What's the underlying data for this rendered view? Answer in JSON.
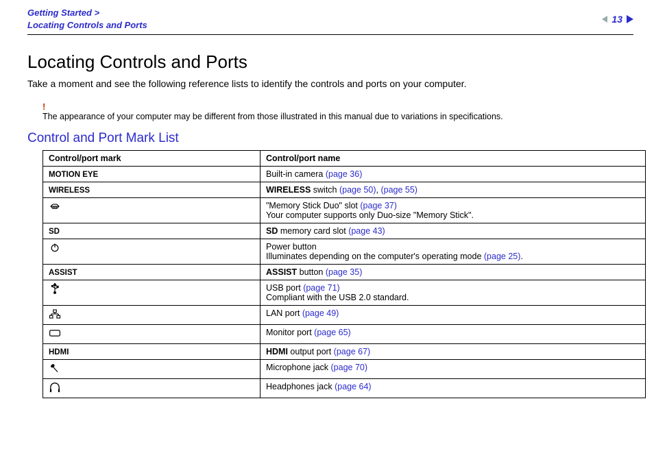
{
  "breadcrumb": {
    "line1": "Getting Started >",
    "line2": "Locating Controls and Ports"
  },
  "pagination": {
    "page_number": "13"
  },
  "title": "Locating Controls and Ports",
  "intro": "Take a moment and see the following reference lists to identify the controls and ports on your computer.",
  "note": {
    "bang": "!",
    "text": "The appearance of your computer may be different from those illustrated in this manual due to variations in specifications."
  },
  "section_heading": "Control and Port Mark List",
  "table_headers": {
    "mark": "Control/port mark",
    "name": "Control/port name"
  },
  "rows": {
    "motion_eye": {
      "mark_label": "MOTION EYE",
      "prefix": "Built-in camera ",
      "link1": "(page 36)"
    },
    "wireless": {
      "mark_label": "WIRELESS",
      "bold": "WIRELESS",
      "after_bold": " switch ",
      "link1": "(page 50)",
      "sep": ", ",
      "link2": "(page 55)"
    },
    "memstick": {
      "line1_prefix": "\"Memory Stick Duo\" slot ",
      "line1_link": "(page 37)",
      "line2": "Your computer supports only Duo-size \"Memory Stick\"."
    },
    "sd": {
      "mark_label": "SD",
      "bold": "SD",
      "after_bold": " memory card slot ",
      "link1": "(page 43)"
    },
    "power": {
      "line1": "Power button",
      "line2_prefix": "Illuminates depending on the computer's operating mode ",
      "line2_link": "(page 25)",
      "line2_suffix": "."
    },
    "assist": {
      "mark_label": "ASSIST",
      "bold": "ASSIST",
      "after_bold": " button ",
      "link1": "(page 35)"
    },
    "usb": {
      "line1_prefix": "USB port ",
      "line1_link": "(page 71)",
      "line2": "Compliant with the USB 2.0 standard."
    },
    "lan": {
      "prefix": "LAN port ",
      "link1": "(page 49)"
    },
    "monitor": {
      "prefix": "Monitor port ",
      "link1": "(page 65)"
    },
    "hdmi": {
      "mark_label": "HDMI",
      "bold": "HDMI",
      "after_bold": " output port ",
      "link1": "(page 67)"
    },
    "mic": {
      "prefix": "Microphone jack ",
      "link1": "(page 70)"
    },
    "headphones": {
      "prefix": "Headphones jack ",
      "link1": "(page 64)"
    }
  }
}
